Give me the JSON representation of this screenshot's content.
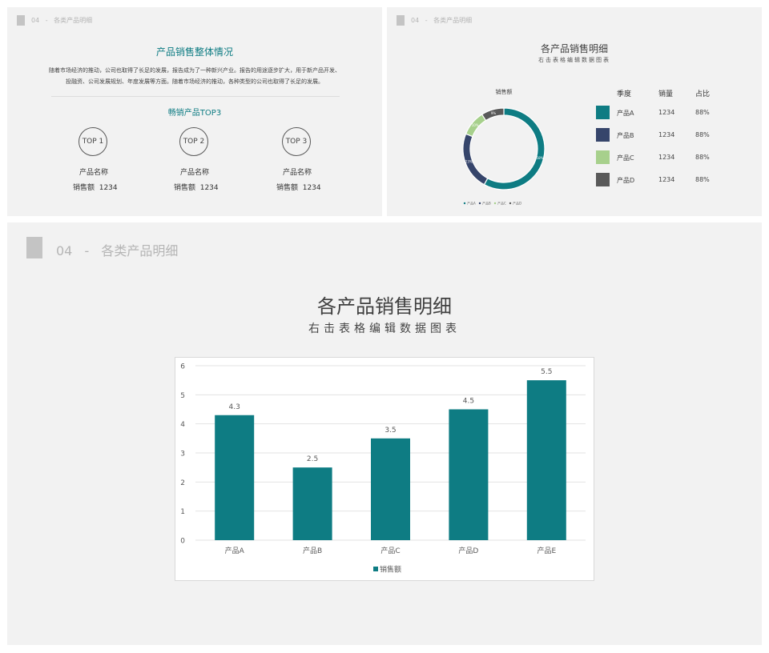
{
  "slide1": {
    "header": {
      "num": "04",
      "sep": "-",
      "title": "各类产品明细"
    },
    "heading": "产品销售整体情况",
    "paragraph_line1": "随着市场经济的推动，公司也取得了长足的发展，报告成为了一种新兴产业。报告的用途逐步扩大，用于新产品开发、",
    "paragraph_line2": "投融资、公司发展规划、年度发展等方面。随着市场经济的推动，各种类型的公司也取得了长足的发展。",
    "top3_title": "畅销产品TOP3",
    "tops": [
      {
        "badge": "TOP 1",
        "name": "产品名称",
        "sales": "销售额  1234"
      },
      {
        "badge": "TOP 2",
        "name": "产品名称",
        "sales": "销售额  1234"
      },
      {
        "badge": "TOP 3",
        "name": "产品名称",
        "sales": "销售额  1234"
      }
    ]
  },
  "slide2": {
    "header": {
      "num": "04",
      "sep": "-",
      "title": "各类产品明细"
    },
    "title": "各产品销售明细",
    "subtitle": "右击表格编辑数据图表",
    "donut_title": "销售额",
    "table": {
      "headers": [
        "季度",
        "销量",
        "占比"
      ],
      "rows": [
        {
          "name": "产品A",
          "qty": "1234",
          "pct": "88%",
          "color": "#0e7c83"
        },
        {
          "name": "产品B",
          "qty": "1234",
          "pct": "88%",
          "color": "#36456b"
        },
        {
          "name": "产品C",
          "qty": "1234",
          "pct": "88%",
          "color": "#a7d08c"
        },
        {
          "name": "产品D",
          "qty": "1234",
          "pct": "88%",
          "color": "#595959"
        }
      ]
    },
    "chart_data": {
      "type": "pie",
      "title": "销售额",
      "categories": [
        "产品A",
        "产品B",
        "产品C",
        "产品D"
      ],
      "values": [
        58,
        23,
        10,
        9
      ],
      "labels": [
        "58%",
        "23%",
        "10%",
        "9%"
      ],
      "colors": [
        "#0e7c83",
        "#36456b",
        "#a7d08c",
        "#595959"
      ],
      "legend": "bottom"
    }
  },
  "slide3": {
    "header": {
      "num": "04",
      "sep": "-",
      "title": "各类产品明细"
    },
    "title": "各产品销售明细",
    "subtitle": "右击表格编辑数据图表",
    "chart_data": {
      "type": "bar",
      "categories": [
        "产品A",
        "产品B",
        "产品C",
        "产品D",
        "产品E"
      ],
      "series": [
        {
          "name": "销售额",
          "values": [
            4.3,
            2.5,
            3.5,
            4.5,
            5.5
          ]
        }
      ],
      "ylim": [
        0,
        6
      ],
      "yticks": [
        "0",
        "1",
        "2",
        "3",
        "4",
        "5",
        "6"
      ],
      "bar_color": "#0e7c83",
      "grid": true,
      "legend": "bottom"
    }
  }
}
